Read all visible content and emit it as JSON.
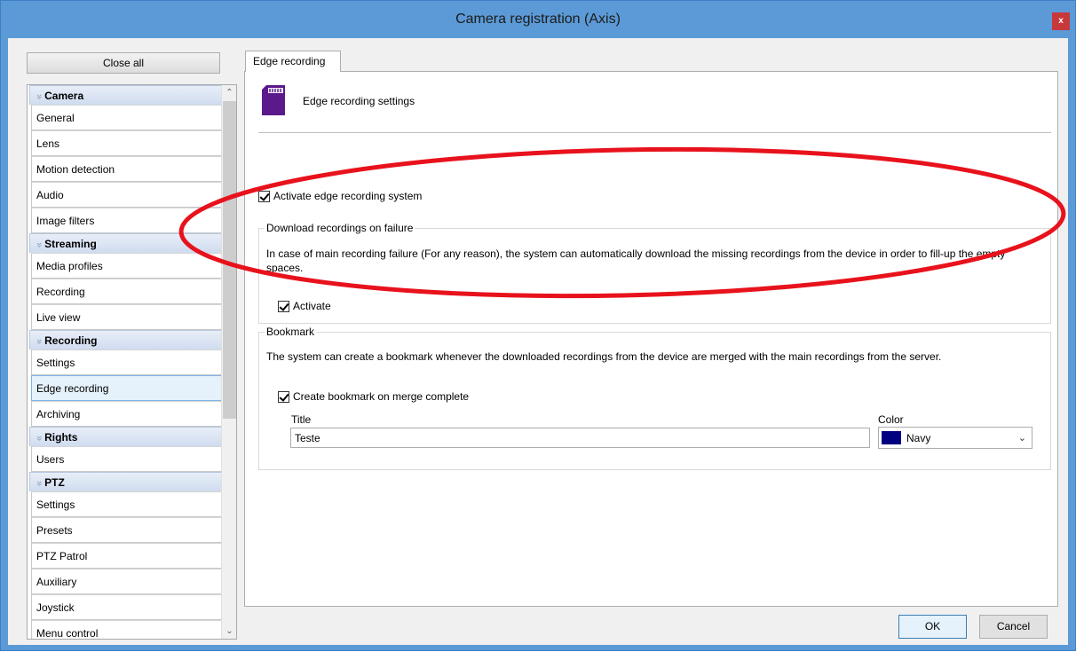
{
  "window": {
    "title": "Camera registration (Axis)",
    "close_glyph": "x"
  },
  "sidebar": {
    "close_all_label": "Close all",
    "groups": [
      {
        "label": "Camera",
        "items": [
          "General",
          "Lens",
          "Motion detection",
          "Audio",
          "Image filters"
        ]
      },
      {
        "label": "Streaming",
        "items": [
          "Media profiles",
          "Recording",
          "Live view"
        ]
      },
      {
        "label": "Recording",
        "items": [
          "Settings",
          "Edge recording",
          "Archiving"
        ]
      },
      {
        "label": "Rights",
        "items": [
          "Users"
        ]
      },
      {
        "label": "PTZ",
        "items": [
          "Settings",
          "Presets",
          "PTZ Patrol",
          "Auxiliary",
          "Joystick",
          "Menu control"
        ]
      }
    ],
    "selected_item": "Edge recording"
  },
  "tab": {
    "label": "Edge recording"
  },
  "header": {
    "text": "Edge recording settings",
    "icon": "sd-card-icon"
  },
  "activate_edge": {
    "label": "Activate edge recording system",
    "checked": true
  },
  "download_group": {
    "title": "Download recordings on failure",
    "description": "In case of main recording failure (For any reason), the system can automatically download the missing recordings from the device in order to fill-up the empty spaces.",
    "activate_label": "Activate",
    "activate_checked": true
  },
  "bookmark_group": {
    "title": "Bookmark",
    "description": "The system can create a bookmark whenever the downloaded recordings from the device are merged with the main recordings from the server.",
    "create_label": "Create bookmark on merge complete",
    "create_checked": true,
    "title_label": "Title",
    "title_value": "Teste",
    "color_label": "Color",
    "color_value": "Navy",
    "color_hex": "#000080"
  },
  "buttons": {
    "ok": "OK",
    "cancel": "Cancel"
  },
  "colors": {
    "titlebar": "#5b9ad6",
    "close": "#c7383b",
    "annotation": "#e8121c"
  }
}
